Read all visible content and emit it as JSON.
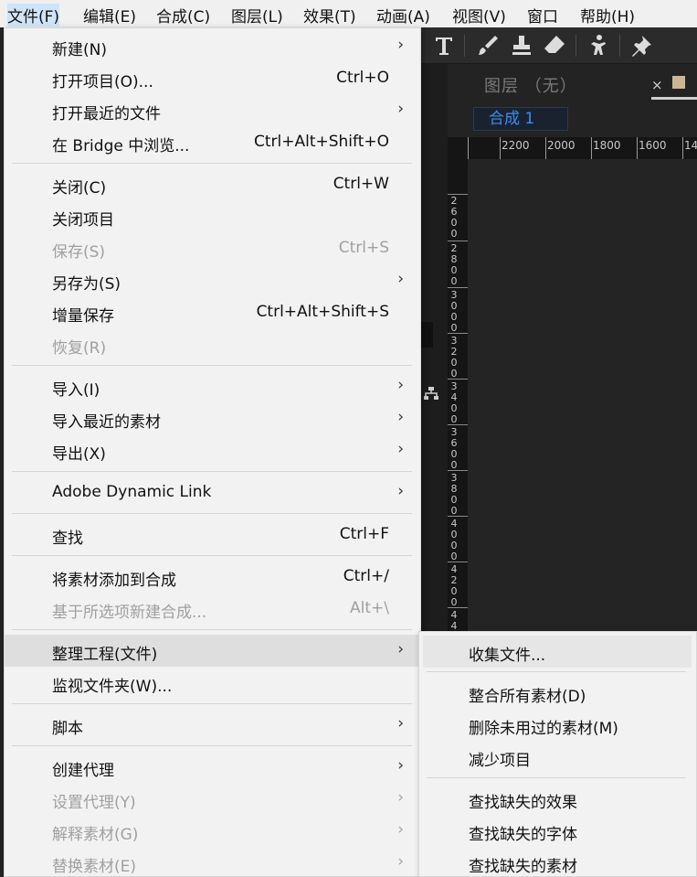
{
  "menubar": {
    "items": [
      "文件(F)",
      "编辑(E)",
      "合成(C)",
      "图层(L)",
      "效果(T)",
      "动画(A)",
      "视图(V)",
      "窗口",
      "帮助(H)"
    ]
  },
  "toolbar": {
    "icons": [
      "type-tool-icon",
      "brush-tool-icon",
      "clone-stamp-icon",
      "eraser-icon",
      "puppet-tool-icon",
      "pin-tool-icon"
    ]
  },
  "layer_panel": {
    "title": "图层 （无）",
    "close_glyph": "×",
    "comp_tab": "合成 1",
    "swatch_color": "#cdb394"
  },
  "ruler": {
    "top_labels": [
      "2200",
      "2000",
      "1800",
      "1600",
      "14"
    ],
    "left_labels": [
      "2600",
      "2800",
      "3000",
      "3200",
      "3400",
      "3600",
      "3800",
      "4000",
      "4200",
      "44"
    ]
  },
  "file_menu": {
    "items": [
      {
        "label": "新建(N)",
        "shortcut": "",
        "submenu": true,
        "disabled": false
      },
      {
        "label": "打开项目(O)...",
        "shortcut": "Ctrl+O",
        "submenu": false,
        "disabled": false
      },
      {
        "label": "打开最近的文件",
        "shortcut": "",
        "submenu": true,
        "disabled": false
      },
      {
        "label": "在 Bridge 中浏览...",
        "shortcut": "Ctrl+Alt+Shift+O",
        "submenu": false,
        "disabled": false
      },
      {
        "label": "关闭(C)",
        "shortcut": "Ctrl+W",
        "submenu": false,
        "disabled": false
      },
      {
        "label": "关闭项目",
        "shortcut": "",
        "submenu": false,
        "disabled": false
      },
      {
        "label": "保存(S)",
        "shortcut": "Ctrl+S",
        "submenu": false,
        "disabled": true
      },
      {
        "label": "另存为(S)",
        "shortcut": "",
        "submenu": true,
        "disabled": false
      },
      {
        "label": "增量保存",
        "shortcut": "Ctrl+Alt+Shift+S",
        "submenu": false,
        "disabled": false
      },
      {
        "label": "恢复(R)",
        "shortcut": "",
        "submenu": false,
        "disabled": true
      },
      {
        "label": "导入(I)",
        "shortcut": "",
        "submenu": true,
        "disabled": false
      },
      {
        "label": "导入最近的素材",
        "shortcut": "",
        "submenu": true,
        "disabled": false
      },
      {
        "label": "导出(X)",
        "shortcut": "",
        "submenu": true,
        "disabled": false
      },
      {
        "label": "Adobe Dynamic Link",
        "shortcut": "",
        "submenu": true,
        "disabled": false
      },
      {
        "label": "查找",
        "shortcut": "Ctrl+F",
        "submenu": false,
        "disabled": false
      },
      {
        "label": "将素材添加到合成",
        "shortcut": "Ctrl+/",
        "submenu": false,
        "disabled": false
      },
      {
        "label": "基于所选项新建合成...",
        "shortcut": "Alt+\\",
        "submenu": false,
        "disabled": true
      },
      {
        "label": "整理工程(文件)",
        "shortcut": "",
        "submenu": true,
        "disabled": false,
        "hover": true
      },
      {
        "label": "监视文件夹(W)...",
        "shortcut": "",
        "submenu": false,
        "disabled": false
      },
      {
        "label": "脚本",
        "shortcut": "",
        "submenu": true,
        "disabled": false
      },
      {
        "label": "创建代理",
        "shortcut": "",
        "submenu": true,
        "disabled": false
      },
      {
        "label": "设置代理(Y)",
        "shortcut": "",
        "submenu": true,
        "disabled": true
      },
      {
        "label": "解释素材(G)",
        "shortcut": "",
        "submenu": true,
        "disabled": true
      },
      {
        "label": "替换素材(E)",
        "shortcut": "",
        "submenu": true,
        "disabled": true
      }
    ],
    "arrow_glyph": "›"
  },
  "dependencies_submenu": {
    "items": [
      {
        "label": "收集文件...",
        "hover": true
      },
      {
        "label": "整合所有素材(D)"
      },
      {
        "label": "删除未用过的素材(M)"
      },
      {
        "label": "减少项目"
      },
      {
        "label": "查找缺失的效果"
      },
      {
        "label": "查找缺失的字体"
      },
      {
        "label": "查找缺失的素材"
      }
    ]
  }
}
